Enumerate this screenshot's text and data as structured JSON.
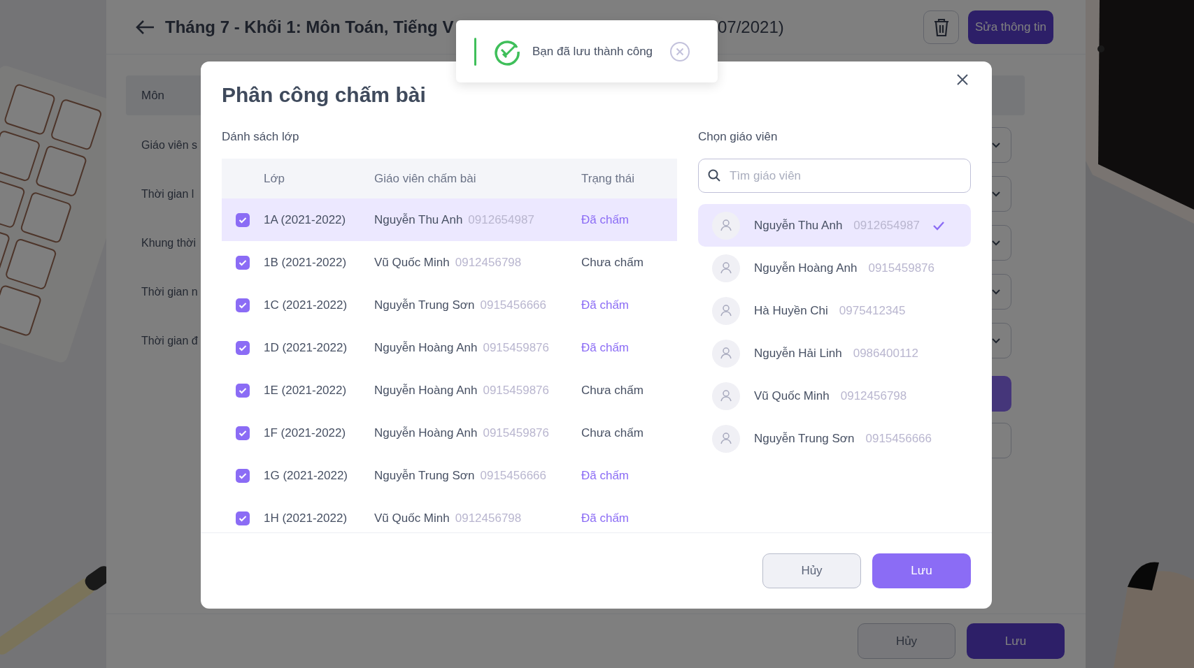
{
  "page": {
    "title": "Tháng 7 - Khối 1: Môn Toán, Tiếng V",
    "title_end": "07/2021)",
    "edit_button": "Sửa thông tin",
    "form_header": "Môn",
    "form_labels": [
      "Giáo viên s",
      "Thời gian l",
      "Khung thời",
      "Thời gian n",
      "Thời gian đ"
    ],
    "footer_buttons": [
      {
        "label": "Hủy",
        "kind": "secondary"
      },
      {
        "label": "Lưu",
        "kind": "primary"
      }
    ]
  },
  "toast": {
    "message": "Bạn đã lưu thành công"
  },
  "modal": {
    "title": "Phân công chấm bài",
    "class_list_label": "Dánh sách lớp",
    "columns": [
      "Lớp",
      "Giáo viên chấm bài",
      "Trạng thái"
    ],
    "classes": [
      {
        "class": "1A (2021-2022)",
        "teacher": "Nguyễn Thu Anh",
        "phone": "0912654987",
        "status": "Đã chấm",
        "graded": true,
        "checked": true,
        "selected": true
      },
      {
        "class": "1B (2021-2022)",
        "teacher": "Vũ Quốc Minh",
        "phone": "0912456798",
        "status": "Chưa chấm",
        "graded": false,
        "checked": true,
        "selected": false
      },
      {
        "class": "1C (2021-2022)",
        "teacher": "Nguyễn Trung Sơn",
        "phone": "0915456666",
        "status": "Đã chấm",
        "graded": true,
        "checked": true,
        "selected": false
      },
      {
        "class": "1D (2021-2022)",
        "teacher": "Nguyễn Hoàng Anh",
        "phone": "0915459876",
        "status": "Đã chấm",
        "graded": true,
        "checked": true,
        "selected": false
      },
      {
        "class": "1E (2021-2022)",
        "teacher": "Nguyễn Hoàng Anh",
        "phone": "0915459876",
        "status": "Chưa chấm",
        "graded": false,
        "checked": true,
        "selected": false
      },
      {
        "class": "1F (2021-2022)",
        "teacher": "Nguyễn Hoàng Anh",
        "phone": "0915459876",
        "status": "Chưa chấm",
        "graded": false,
        "checked": true,
        "selected": false
      },
      {
        "class": "1G (2021-2022)",
        "teacher": "Nguyễn Trung Sơn",
        "phone": "0915456666",
        "status": "Đã chấm",
        "graded": true,
        "checked": true,
        "selected": false
      },
      {
        "class": "1H (2021-2022)",
        "teacher": "Vũ Quốc Minh",
        "phone": "0912456798",
        "status": "Đã chấm",
        "graded": true,
        "checked": true,
        "selected": false
      }
    ],
    "teacher_label": "Chọn giáo viên",
    "search": {
      "placeholder": "Tìm giáo viên"
    },
    "teachers": [
      {
        "name": "Nguyễn Thu Anh",
        "phone": "0912654987",
        "selected": true
      },
      {
        "name": "Nguyễn Hoàng Anh",
        "phone": "0915459876",
        "selected": false
      },
      {
        "name": "Hà Huyền Chi",
        "phone": "0975412345",
        "selected": false
      },
      {
        "name": "Nguyễn Hải Linh",
        "phone": "0986400112",
        "selected": false
      },
      {
        "name": "Vũ Quốc Minh",
        "phone": "0912456798",
        "selected": false
      },
      {
        "name": "Nguyễn Trung Sơn",
        "phone": "0915456666",
        "selected": false
      }
    ],
    "buttons": [
      {
        "label": "Hủy",
        "kind": "secondary"
      },
      {
        "label": "Lưu",
        "kind": "primary"
      }
    ]
  }
}
